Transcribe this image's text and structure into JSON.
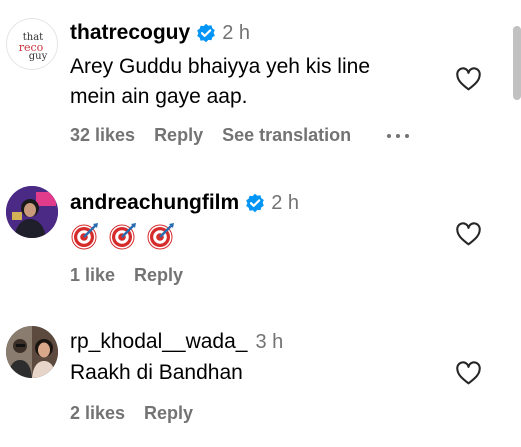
{
  "comments": [
    {
      "username": "thatrecoguy",
      "verified": true,
      "time": "2 h",
      "text_lines": [
        "Arey Guddu bhaiyya yeh kis line",
        "mein ain gaye aap."
      ],
      "likes": "32 likes",
      "reply": "Reply",
      "see_translation": "See translation",
      "avatar_logo": "that reco guy"
    },
    {
      "username": "andreachungfilm",
      "verified": true,
      "time": "2 h",
      "emoji": [
        "🎯",
        "🎯",
        "🎯"
      ],
      "likes": "1 like",
      "reply": "Reply"
    },
    {
      "username": "rp_khodal__wada_",
      "verified": false,
      "time": "3 h",
      "text_lines": [
        "Raakh di Bandhan"
      ],
      "likes": "2 likes",
      "reply": "Reply"
    }
  ],
  "colors": {
    "verified_blue": "#0095f6",
    "muted_text": "#737373",
    "logo_red": "#c9323b"
  }
}
